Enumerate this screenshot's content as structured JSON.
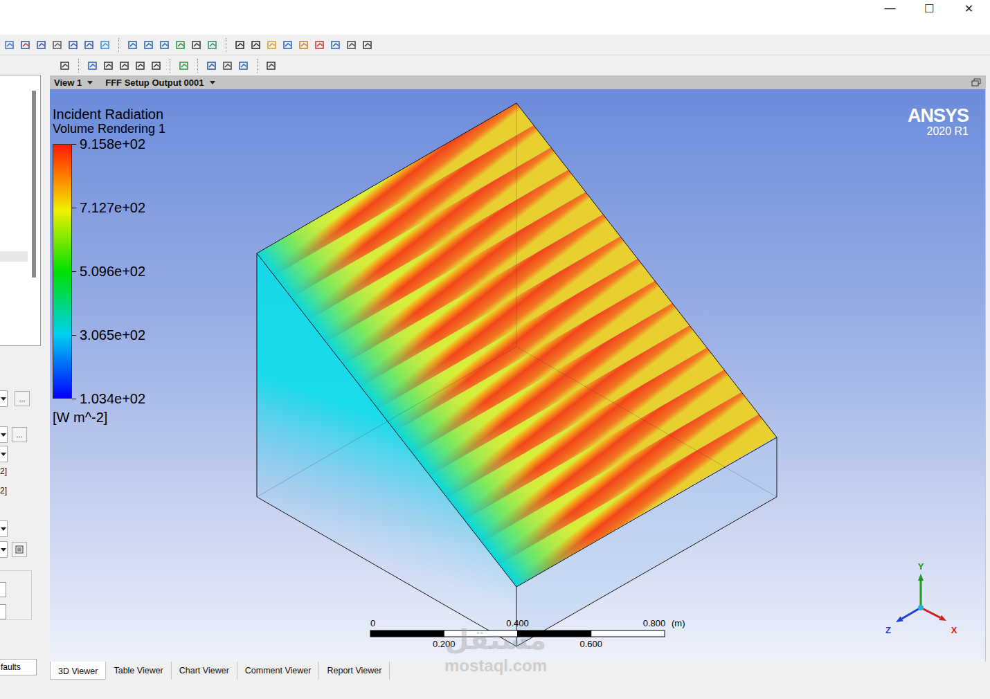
{
  "window": {
    "controls": [
      "—",
      "☐",
      "✕"
    ]
  },
  "left_panel": {
    "browse_buttons": [
      "...",
      "..."
    ],
    "labels": [
      "2]",
      "2]"
    ],
    "defaults_button": "faults"
  },
  "viewport": {
    "view": "View 1",
    "output": "FFF Setup Output 0001"
  },
  "legend": {
    "title": "Incident Radiation",
    "subtitle": "Volume Rendering 1",
    "ticks": [
      "9.158e+02",
      "7.127e+02",
      "5.096e+02",
      "3.065e+02",
      "1.034e+02"
    ],
    "unit": "[W m^-2]"
  },
  "logo": {
    "name": "ANSYS",
    "version": "2020 R1"
  },
  "scale_bar": {
    "top_labels": [
      "0",
      "0.400",
      "0.800"
    ],
    "bottom_labels": [
      "0.200",
      "0.600"
    ],
    "unit": "(m)"
  },
  "axes": [
    {
      "label": "Y",
      "color": "#1a9a1a"
    },
    {
      "label": "Z",
      "color": "#1f3fd0"
    },
    {
      "label": "X",
      "color": "#d01f1f"
    }
  ],
  "tabs": [
    {
      "label": "3D Viewer",
      "selected": true
    },
    {
      "label": "Table Viewer",
      "selected": false
    },
    {
      "label": "Chart Viewer",
      "selected": false
    },
    {
      "label": "Comment Viewer",
      "selected": false
    },
    {
      "label": "Report Viewer",
      "selected": false
    }
  ],
  "watermark": {
    "arabic": "مستقل",
    "latin": "mostaql.com"
  }
}
